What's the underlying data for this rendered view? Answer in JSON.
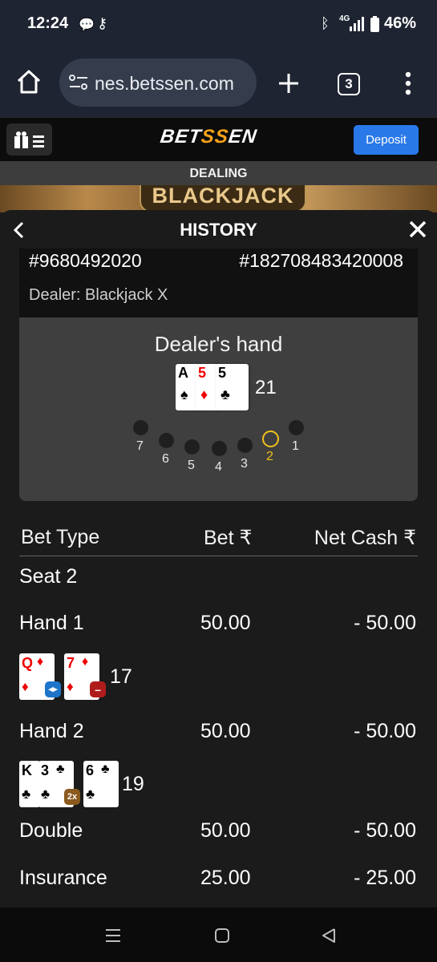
{
  "status_bar": {
    "time": "12:24",
    "battery": "46%",
    "network": "4G"
  },
  "browser": {
    "url": "nes.betssen.com",
    "tab_count": "3"
  },
  "site": {
    "logo_prefix": "BET",
    "logo_mid": "SS",
    "logo_suffix": "EN",
    "deposit_label": "Deposit"
  },
  "game": {
    "status": "DEALING",
    "title": "BLACKJACK"
  },
  "history": {
    "title": "HISTORY",
    "round_id": "#9680492020",
    "game_id": "#182708483420008",
    "dealer_label": "Dealer: Blackjack X",
    "dealer_hand": {
      "title": "Dealer's hand",
      "cards": [
        {
          "rank": "A",
          "suit": "♠",
          "color": "#000000"
        },
        {
          "rank": "5",
          "suit": "♦",
          "color": "#e00000"
        },
        {
          "rank": "5",
          "suit": "♣",
          "color": "#000000"
        }
      ],
      "total": "21"
    },
    "seats": [
      "7",
      "6",
      "5",
      "4",
      "3",
      "2",
      "1"
    ],
    "active_seat": "2",
    "table": {
      "headers": {
        "bet_type": "Bet Type",
        "bet": "Bet ₹",
        "net_cash": "Net Cash ₹"
      },
      "seat_label": "Seat 2",
      "hand1": {
        "label": "Hand 1",
        "bet": "50.00",
        "net": "- 50.00",
        "total": "17",
        "cards": [
          {
            "rank": "Q",
            "suit": "♦"
          },
          {
            "rank": "7",
            "suit": "♦"
          }
        ]
      },
      "hand2": {
        "label": "Hand 2",
        "bet": "50.00",
        "net": "- 50.00",
        "total": "19",
        "cards": [
          {
            "rank": "K",
            "suit": "♣"
          },
          {
            "rank": "3",
            "suit": "♣"
          },
          {
            "rank": "6",
            "suit": "♣"
          }
        ],
        "badge": "2x"
      },
      "double": {
        "label": "Double",
        "bet": "50.00",
        "net": "- 50.00"
      },
      "insurance": {
        "label": "Insurance",
        "bet": "25.00",
        "net": "- 25.00"
      }
    }
  },
  "colors": {
    "deposit": "#2979e8",
    "logo_accent": "#f6a21a",
    "active_seat": "#f1c21b",
    "red_suit": "#e00000"
  }
}
